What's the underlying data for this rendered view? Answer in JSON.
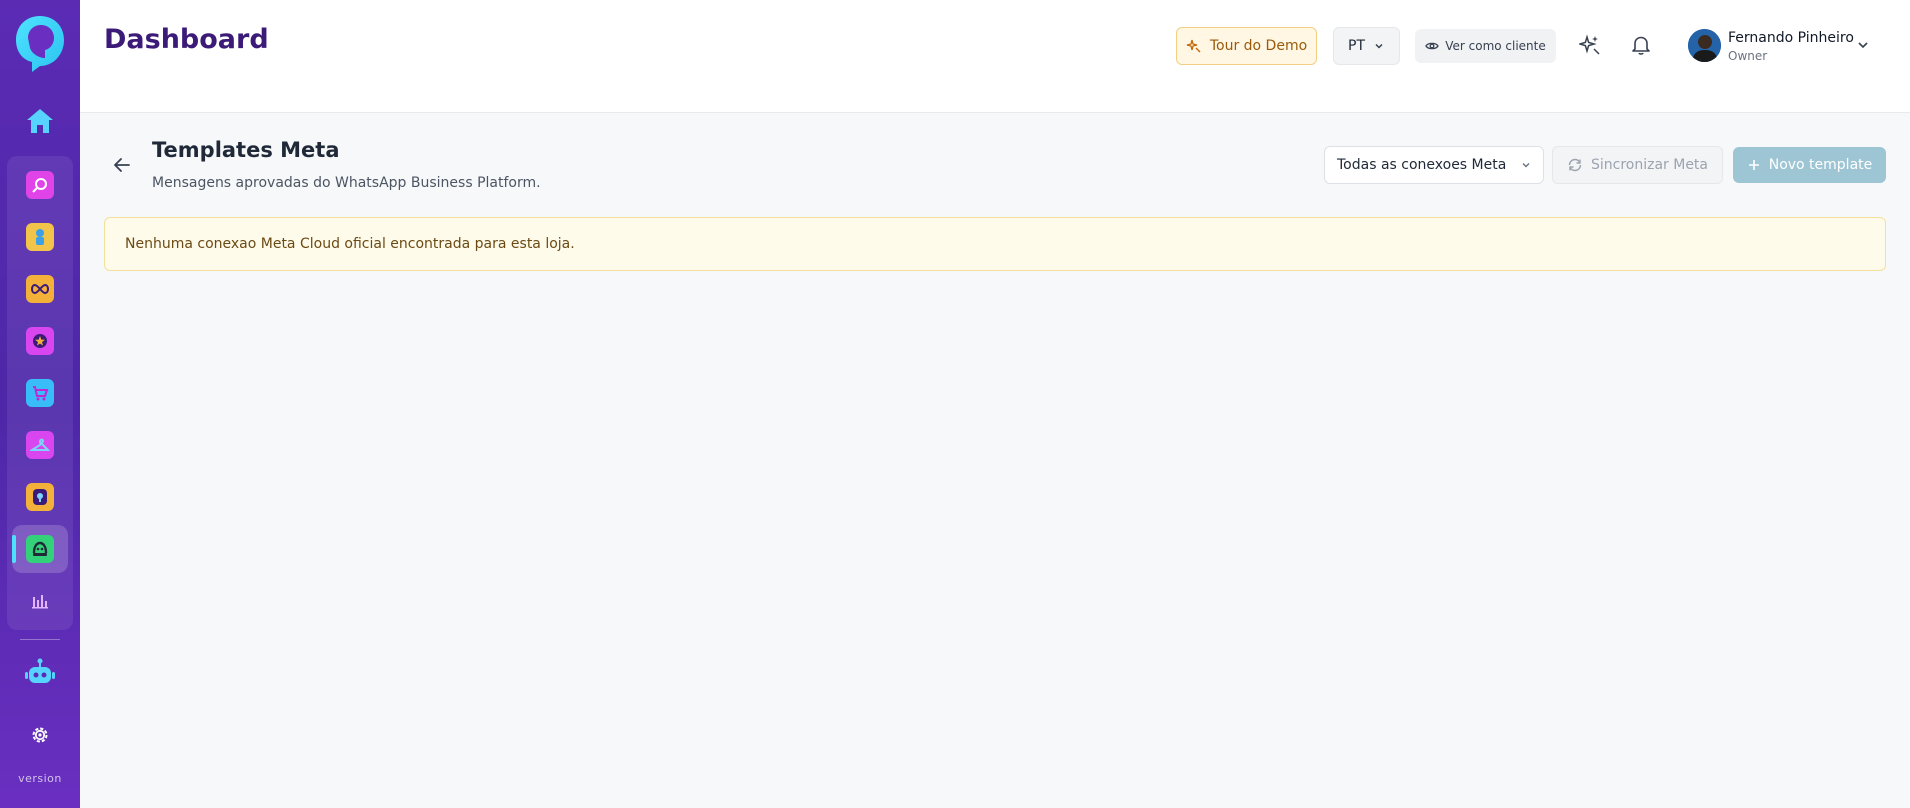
{
  "header": {
    "title": "Dashboard",
    "tour_label": "Tour do Demo",
    "language": "PT",
    "view_as_client_label": "Ver como cliente",
    "user": {
      "name": "Fernando Pinheiro",
      "role": "Owner"
    }
  },
  "sidebar": {
    "version_label": "version",
    "apps": [
      {
        "name": "search-app",
        "color": "#e044e8"
      },
      {
        "name": "person-app",
        "color": "#f3c44a"
      },
      {
        "name": "infinity-app",
        "color": "#f4b13a"
      },
      {
        "name": "star-app",
        "color": "#d946ef"
      },
      {
        "name": "cart-app",
        "color": "#38bdf8"
      },
      {
        "name": "hanger-app",
        "color": "#d946ef"
      },
      {
        "name": "pin-app",
        "color": "#f4b13a"
      },
      {
        "name": "bot-app",
        "color": "#33d17a"
      },
      {
        "name": "chart-app",
        "color": "#e3b5ff"
      }
    ]
  },
  "page": {
    "title": "Templates Meta",
    "subtitle": "Mensagens aprovadas do WhatsApp Business Platform.",
    "connection_filter": "Todas as conexoes Meta",
    "sync_label": "Sincronizar Meta",
    "new_template_label": "Novo template",
    "alert_text": "Nenhuma conexao Meta Cloud oficial encontrada para esta loja."
  },
  "colors": {
    "sidebar": "#5b2bb4",
    "title": "#3b1a78",
    "primary_disabled": "#9ec5d3",
    "warning_bg": "#fffbea"
  }
}
